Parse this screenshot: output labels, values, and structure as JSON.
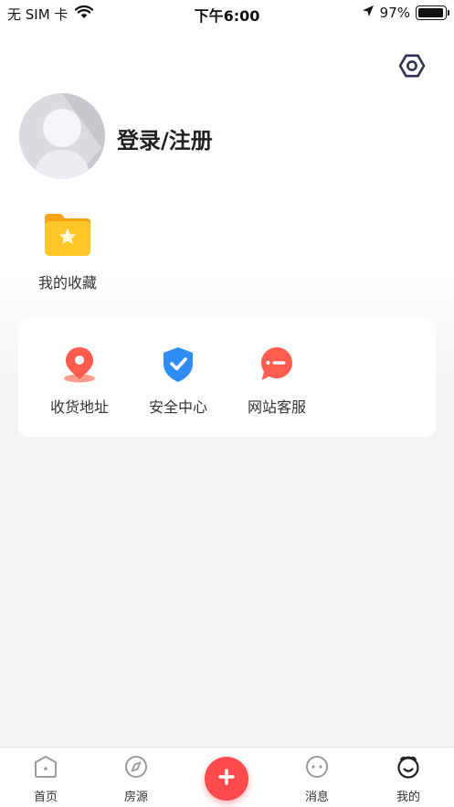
{
  "status_bar": {
    "carrier": "无 SIM 卡",
    "time": "下午6:00",
    "battery_percent": "97%",
    "battery_level": 0.97
  },
  "profile": {
    "login_label": "登录/注册"
  },
  "favorites": {
    "label": "我的收藏"
  },
  "services": [
    {
      "label": "收货地址",
      "icon": "location-pin-icon"
    },
    {
      "label": "安全中心",
      "icon": "shield-check-icon"
    },
    {
      "label": "网站客服",
      "icon": "chat-bubble-icon"
    }
  ],
  "tabbar": {
    "tabs": [
      {
        "label": "首页",
        "icon": "home-icon"
      },
      {
        "label": "房源",
        "icon": "compass-icon"
      },
      {
        "label": "消息",
        "icon": "message-icon"
      },
      {
        "label": "我的",
        "icon": "smile-icon",
        "active": true
      }
    ],
    "publish_icon": "plus-icon"
  },
  "colors": {
    "accent_red": "#ff4a4e",
    "folder_yellow": "#ffc21f",
    "shield_blue": "#2f8cf5",
    "settings_icon": "#2d3350",
    "page_bg": "#f4f4f6"
  }
}
